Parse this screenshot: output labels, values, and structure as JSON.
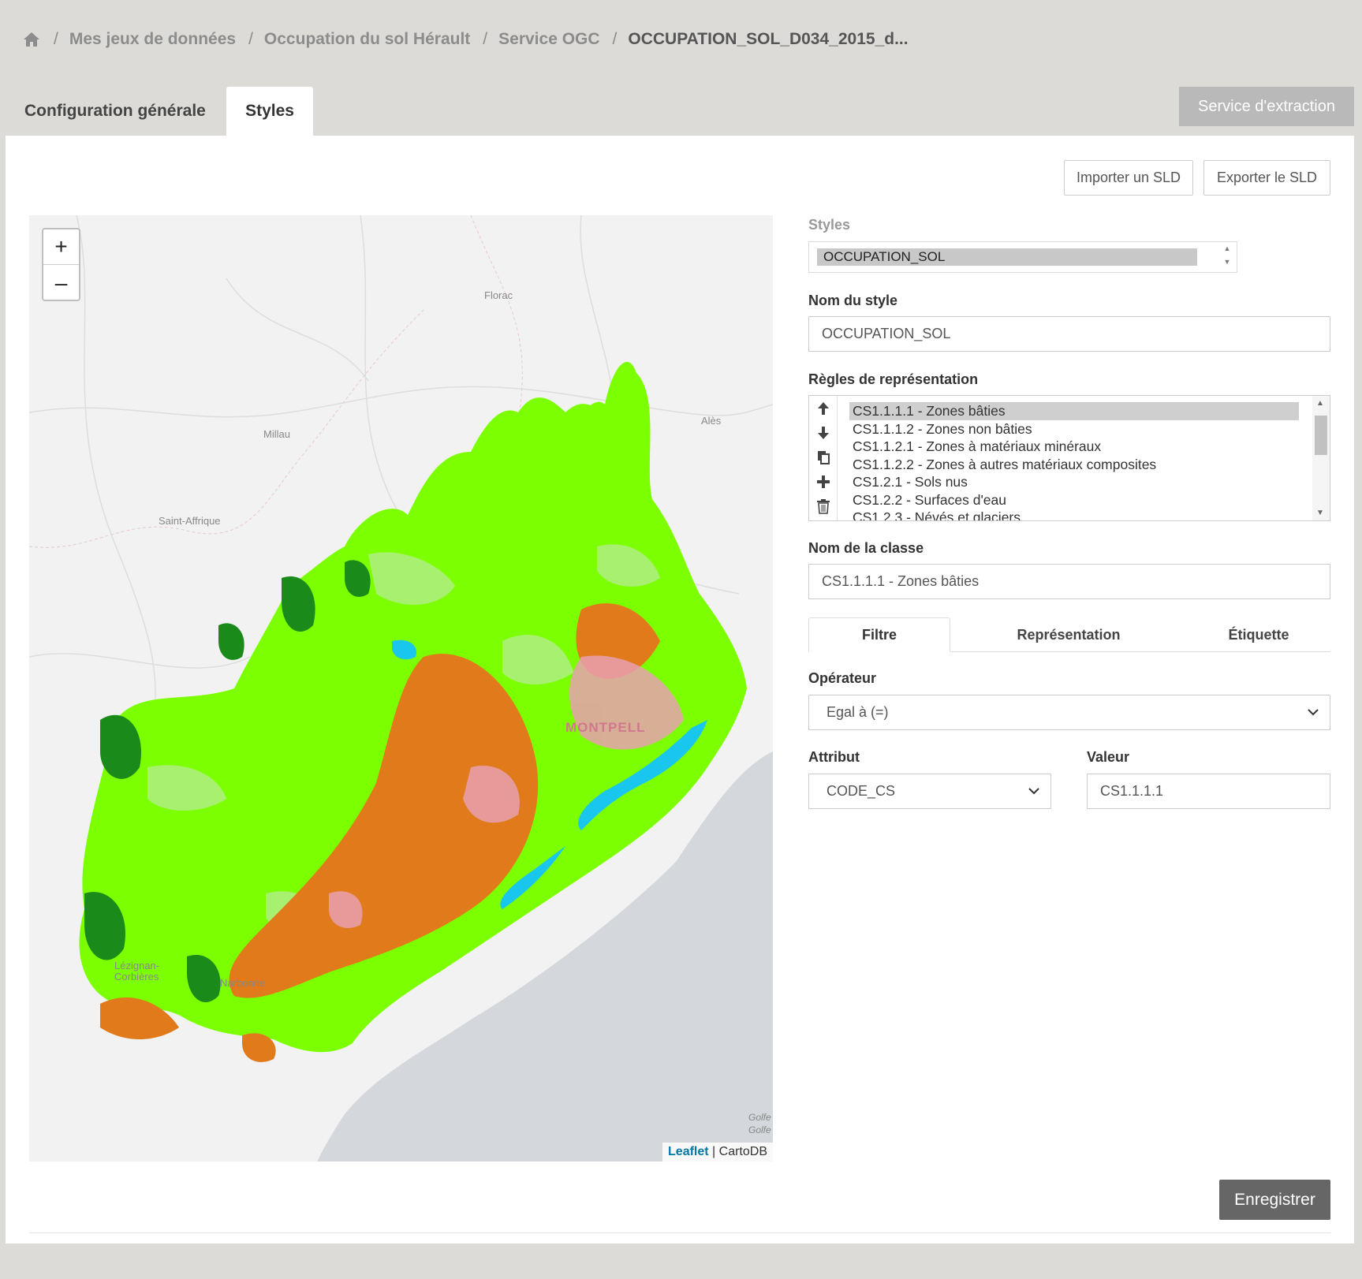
{
  "breadcrumb": {
    "items": [
      "Mes jeux de données",
      "Occupation du sol Hérault",
      "Service OGC"
    ],
    "current": "OCCUPATION_SOL_D034_2015_d...",
    "separator": "/"
  },
  "tabs": {
    "general": "Configuration générale",
    "styles": "Styles"
  },
  "extract_button": "Service d'extraction",
  "sld": {
    "import": "Importer un SLD",
    "export": "Exporter le SLD"
  },
  "map": {
    "zoom_in": "+",
    "zoom_out": "–",
    "attribution_leaflet": "Leaflet",
    "attribution_sep": " | ",
    "attribution_tiles": "CartoDB",
    "places": [
      "Florac",
      "Alès",
      "Millau",
      "Saint-Affrique",
      "Lézignan-",
      "Corbières",
      "Narbonne",
      "MONTPELL",
      "Golfe",
      "Golfe"
    ],
    "colors": {
      "forest_light": "#7cff00",
      "forest_dark": "#1a8a1a",
      "pasture": "#a8f070",
      "agri": "#e07a1a",
      "urban": "#e8a0b0",
      "water": "#19c6ee",
      "sea": "#d4d8dc",
      "land": "#f2f2f2"
    }
  },
  "form": {
    "styles_label": "Styles",
    "styles_value": "OCCUPATION_SOL",
    "style_name_label": "Nom du style",
    "style_name_value": "OCCUPATION_SOL",
    "rules_label": "Règles de représentation",
    "rules": [
      "CS1.1.1.1 - Zones bâties",
      "CS1.1.1.2 - Zones non bâties",
      "CS1.1.2.1 - Zones à matériaux minéraux",
      "CS1.1.2.2 - Zones à autres matériaux composites",
      "CS1.2.1 - Sols nus",
      "CS1.2.2 - Surfaces d'eau",
      "CS1.2.3 - Névés et glaciers"
    ],
    "rule_tools": [
      "arrow-up-icon",
      "arrow-down-icon",
      "copy-icon",
      "plus-icon",
      "trash-icon"
    ],
    "class_name_label": "Nom de la classe",
    "class_name_value": "CS1.1.1.1 - Zones bâties",
    "subtabs": [
      "Filtre",
      "Représentation",
      "Étiquette"
    ],
    "operator_label": "Opérateur",
    "operator_value": "Egal à (=)",
    "attribute_label": "Attribut",
    "attribute_value": "CODE_CS",
    "value_label": "Valeur",
    "value_value": "CS1.1.1.1"
  },
  "save_button": "Enregistrer"
}
